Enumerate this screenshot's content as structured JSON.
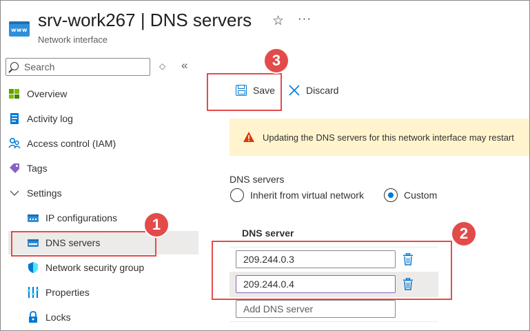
{
  "header": {
    "resource_icon_text": "www",
    "title": "srv-work267 | DNS servers",
    "subtitle": "Network interface",
    "star_icon": "☆",
    "more_icon": "···"
  },
  "search": {
    "placeholder": "Search",
    "sort_icon": "◇",
    "collapse_icon": "«"
  },
  "nav": {
    "items": [
      {
        "label": "Overview",
        "icon": "overview-icon"
      },
      {
        "label": "Activity log",
        "icon": "activity-log-icon"
      },
      {
        "label": "Access control (IAM)",
        "icon": "iam-icon"
      },
      {
        "label": "Tags",
        "icon": "tag-icon"
      },
      {
        "label": "Settings",
        "icon": "chevron-down-icon"
      },
      {
        "label": "IP configurations",
        "icon": "ip-config-icon"
      },
      {
        "label": "DNS servers",
        "icon": "dns-servers-icon",
        "selected": true
      },
      {
        "label": "Network security group",
        "icon": "shield-icon"
      },
      {
        "label": "Properties",
        "icon": "properties-icon"
      },
      {
        "label": "Locks",
        "icon": "lock-icon"
      }
    ]
  },
  "toolbar": {
    "save_label": "Save",
    "discard_label": "Discard"
  },
  "warning": {
    "text": "Updating the DNS servers for this network interface may restart"
  },
  "dns_settings": {
    "section_label": "DNS servers",
    "options": [
      "Inherit from virtual network",
      "Custom"
    ],
    "selected": "Custom",
    "column_header": "DNS server",
    "servers": [
      "209.244.0.3",
      "209.244.0.4"
    ],
    "add_placeholder": "Add DNS server"
  },
  "annotations": {
    "badges": [
      "1",
      "2",
      "3"
    ]
  },
  "colors": {
    "accent": "#0078d4",
    "callout": "#e34b4b",
    "warning_bg": "#fff4ce",
    "selected_bg": "#edebe9"
  }
}
